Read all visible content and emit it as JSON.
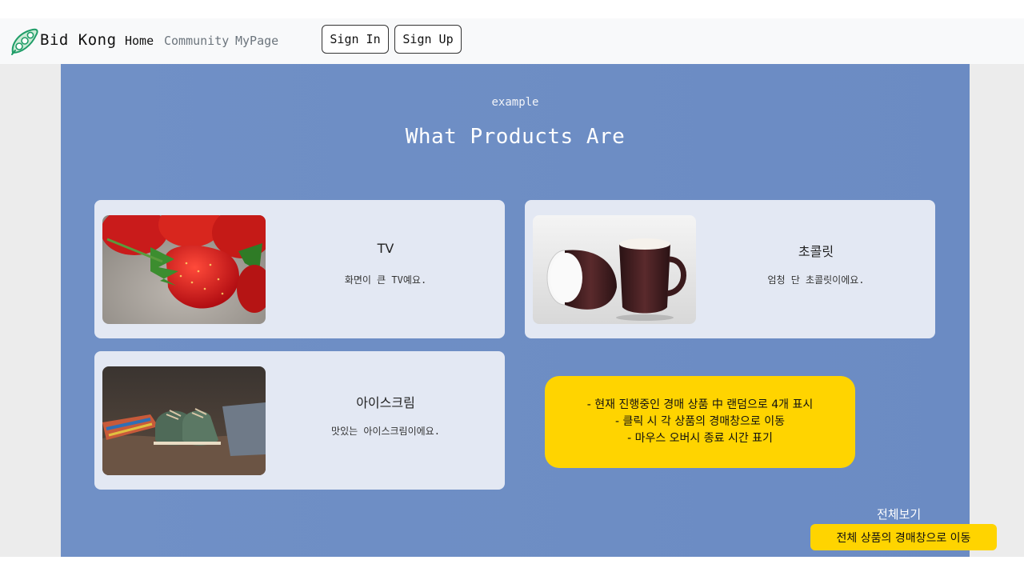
{
  "navbar": {
    "brand": "Bid Kong",
    "logo_icon": "pea-pod-icon",
    "links": [
      "Home",
      "Community",
      "MyPage"
    ],
    "active_link": "Home",
    "sign_in_label": "Sign In",
    "sign_up_label": "Sign Up"
  },
  "section": {
    "eyebrow": "example",
    "heading": "What Products Are"
  },
  "products": [
    {
      "title": "TV",
      "description": "화면이 큰 TV예요.",
      "image": "strawberries-photo"
    },
    {
      "title": "초콜릿",
      "description": "엄청 단 초콜릿이에요.",
      "image": "coffee-mugs-photo"
    },
    {
      "title": "아이스크림",
      "description": "맛있는 아이스크림이에요.",
      "image": "baby-shoes-photo"
    }
  ],
  "annotation": {
    "lines": [
      "- 현재 진행중인 경매 상품 中 랜덤으로 4개 표시",
      "- 클릭 시 각 상품의 경매창으로 이동",
      "- 마우스 오버시 종료 시간 표기"
    ]
  },
  "view_all": {
    "label": "전체보기",
    "note": "전체 상품의 경매창으로 이동"
  },
  "colors": {
    "section_bg": "#6f8fc5",
    "card_bg": "#e3e8f3",
    "annotation_bg": "#ffd400",
    "navbar_bg": "#f8f9fa"
  }
}
